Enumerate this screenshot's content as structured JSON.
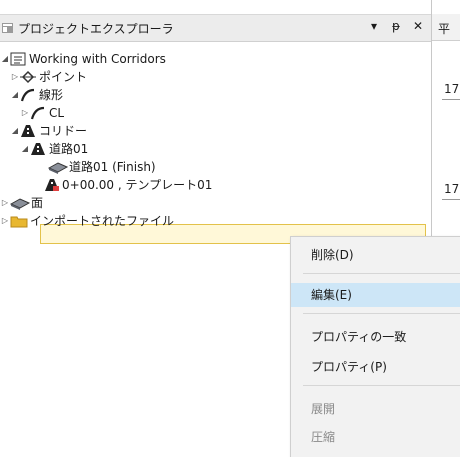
{
  "panel": {
    "title": "プロジェクトエクスプローラ",
    "buttons": {
      "dropdown": "▾",
      "pin": "ᵽ",
      "close": "✕"
    }
  },
  "tree": {
    "root": "Working with Corridors",
    "points": "ポイント",
    "alignments": "線形",
    "cl": "CL",
    "corridors": "コリドー",
    "road01": "道路01",
    "road01_finish": "道路01 (Finish)",
    "template_item": "0+00.00 , テンプレート01",
    "surfaces": "面",
    "imported_files": "インポートされたファイル"
  },
  "right_doc": {
    "tab_label": "平",
    "values": [
      "17",
      "17"
    ]
  },
  "context_menu": {
    "delete": "削除(D)",
    "edit": "編集(E)",
    "match_props": "プロパティの一致",
    "properties": "プロパティ(P)",
    "expand": "展開",
    "collapse": "圧縮"
  },
  "colors": {
    "highlight": "#cde6f7",
    "selection_bg": "#fff8d8",
    "selection_border": "#e3c24a",
    "folder": "#e8b730",
    "corridor": "#222222"
  }
}
